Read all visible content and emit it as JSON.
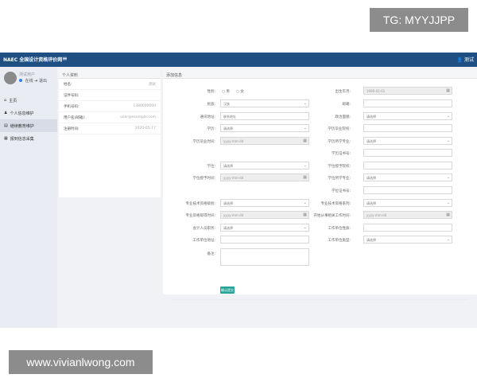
{
  "watermarks": {
    "top": "TG: MYYJJPP",
    "bottom": "www.vivianlwong.com"
  },
  "header": {
    "brand": "NAEC 全国设计资格评价网",
    "menu_icon": "≡",
    "user": "测试"
  },
  "sidebar": {
    "user_name": "测试用户",
    "status": "在线",
    "logout": "退出",
    "items": [
      {
        "icon": "home-icon",
        "label": "主页"
      },
      {
        "icon": "user-icon",
        "label": "个人信息维护"
      },
      {
        "icon": "id-card-icon",
        "label": "继续教育维护"
      },
      {
        "icon": "list-icon",
        "label": "报到信息采集"
      }
    ]
  },
  "profile_panel": {
    "title": "个人资料",
    "rows": [
      {
        "label": "姓名:",
        "value": "测试"
      },
      {
        "label": "证件号码:",
        "value": ""
      },
      {
        "label": "手机号码:",
        "value": "1380000000"
      },
      {
        "label": "用户名(邮箱):",
        "value": "user@example.com"
      },
      {
        "label": "注册时间:",
        "value": "2020-05-17"
      }
    ]
  },
  "form": {
    "title": "添加信息",
    "gender_label": "性别:",
    "gender_options": [
      "男",
      "女"
    ],
    "birth_label": "出生年月:",
    "birth_value": "1990-01-01",
    "nation_label": "民族:",
    "nation_value": "汉族",
    "email_label": "邮箱:",
    "address_label": "通讯地址:",
    "address_value": "联系地址",
    "politics_label": "政治面貌:",
    "politics_value": "请选择",
    "edu_label": "学历:",
    "edu_value": "请选择",
    "edu_school_label": "学历毕业院校:",
    "edu_time_label": "学历毕业时间:",
    "edu_time_value": "yyyy-mm-dd",
    "edu_major_label": "学历所学专业:",
    "edu_major_value": "请选择",
    "edu_cert_label": "学历证书号:",
    "degree_label": "学位:",
    "degree_value": "请选择",
    "degree_school_label": "学位授予院校:",
    "degree_time_label": "学位授予时间:",
    "degree_time_value": "yyyy-mm-dd",
    "degree_major_label": "学位所学专业:",
    "degree_major_value": "请选择",
    "degree_cert_label": "学位证书号:",
    "tech_title_label": "专业技术资格级别:",
    "tech_title_value": "请选择",
    "tech_series_label": "专业技术资格系列:",
    "tech_series_value": "请选择",
    "tech_time_label": "专业资格取得时间:",
    "tech_time_value": "yyyy-mm-dd",
    "work_start_label": "开始从事相关工作时间:",
    "work_start_value": "yyyy-mm-dd",
    "job_label": "会计人员职务:",
    "job_value": "请选择",
    "unit_nature_label": "工作单位性质:",
    "unit_label": "工作单位地址:",
    "unit_type_label": "工作单位类型:",
    "unit_type_value": "请选择",
    "remark_label": "备注:",
    "submit_label": "确认提交",
    "cal_icon": "▦",
    "chevron_icon": "⌄"
  }
}
